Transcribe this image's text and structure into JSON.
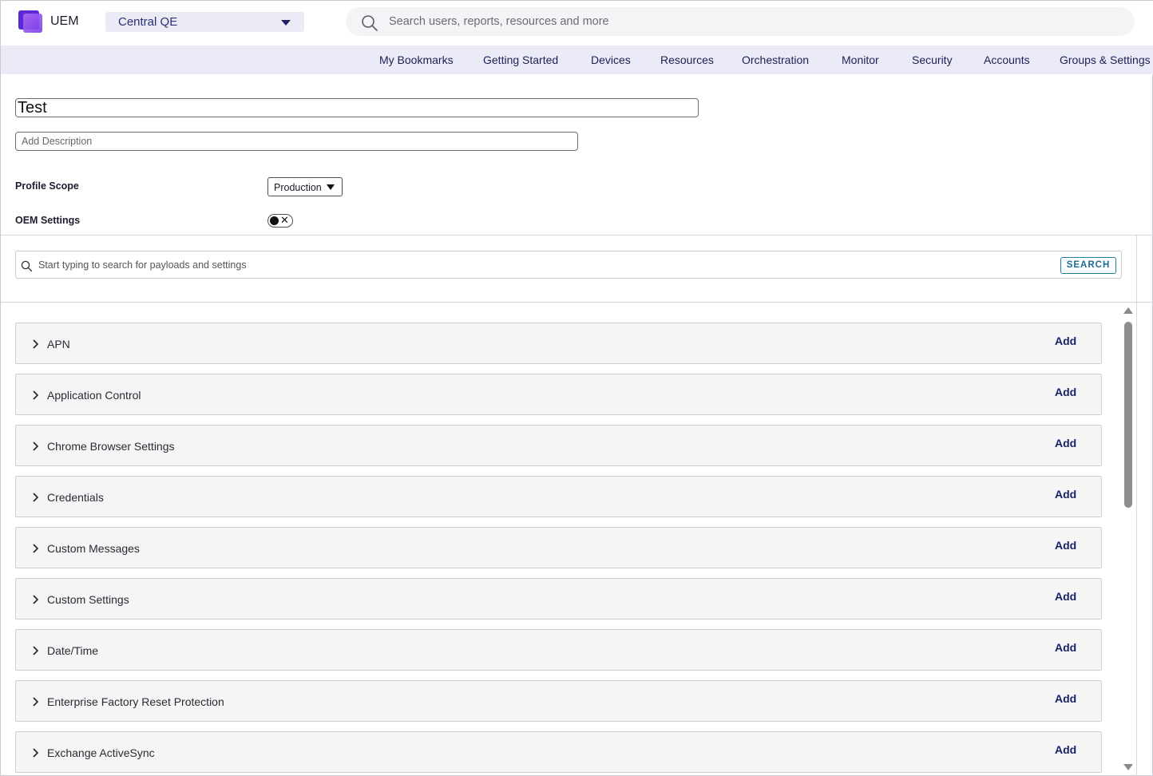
{
  "header": {
    "app_name": "UEM",
    "org_selector": "Central QE",
    "search_placeholder": "Search users, reports, resources and more"
  },
  "nav": [
    {
      "label": "My Bookmarks"
    },
    {
      "label": "Getting Started"
    },
    {
      "label": "Devices"
    },
    {
      "label": "Resources"
    },
    {
      "label": "Orchestration"
    },
    {
      "label": "Monitor"
    },
    {
      "label": "Security"
    },
    {
      "label": "Accounts"
    },
    {
      "label": "Groups & Settings"
    }
  ],
  "profile": {
    "name_value": "Test",
    "description_placeholder": "Add Description",
    "scope_label": "Profile Scope",
    "scope_value": "Production",
    "oem_label": "OEM Settings",
    "oem_enabled": false
  },
  "payload_search": {
    "placeholder": "Start typing to search for payloads and settings",
    "button_label": "SEARCH"
  },
  "payloads": [
    {
      "name": "APN",
      "action": "Add"
    },
    {
      "name": "Application Control",
      "action": "Add"
    },
    {
      "name": "Chrome Browser Settings",
      "action": "Add"
    },
    {
      "name": "Credentials",
      "action": "Add"
    },
    {
      "name": "Custom Messages",
      "action": "Add"
    },
    {
      "name": "Custom Settings",
      "action": "Add"
    },
    {
      "name": "Date/Time",
      "action": "Add"
    },
    {
      "name": "Enterprise Factory Reset Protection",
      "action": "Add"
    },
    {
      "name": "Exchange ActiveSync",
      "action": "Add"
    }
  ],
  "icons": {
    "logo": "uem-logo-icon",
    "org_caret": "chevron-down-icon",
    "global_search": "search-icon",
    "payload_expand": "chevron-right-icon",
    "oem_toggle_off": "close-icon"
  },
  "colors": {
    "nav_background": "#ebebf7",
    "link_text": "#1d2166",
    "search_button": "#1a6d96",
    "logo_primary": "#5b2ad6"
  }
}
